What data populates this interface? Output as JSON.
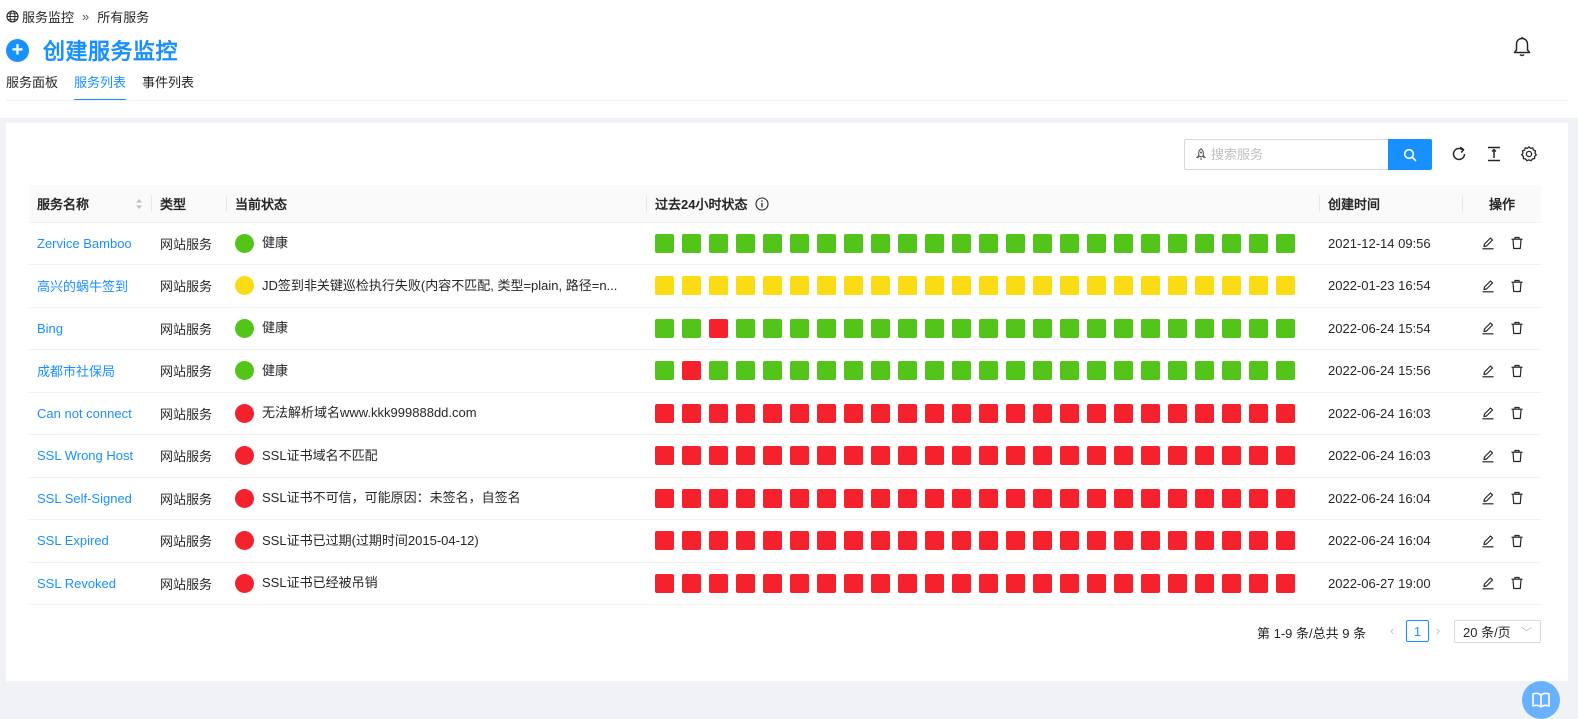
{
  "breadcrumb": {
    "root": "服务监控",
    "separator": "»",
    "current": "所有服务"
  },
  "header": {
    "create_label": "创建服务监控"
  },
  "tabs": [
    {
      "label": "服务面板",
      "active": false
    },
    {
      "label": "服务列表",
      "active": true
    },
    {
      "label": "事件列表",
      "active": false
    }
  ],
  "search": {
    "placeholder": "搜索服务",
    "value": ""
  },
  "colors": {
    "accent": "#1890ff",
    "healthy": "#52c41a",
    "warning": "#fadb14",
    "error": "#f5222d"
  },
  "table": {
    "columns": [
      "服务名称",
      "类型",
      "当前状态",
      "过去24小时状态",
      "创建时间",
      "操作"
    ],
    "rows": [
      {
        "name": "Zervice Bamboo",
        "type": "网站服务",
        "status": "healthy",
        "status_text": "健康",
        "history": "GGGGGGGGGGGGGGGGGGGGGGGG",
        "created": "2021-12-14 09:56"
      },
      {
        "name": "高兴的蜗牛签到",
        "type": "网站服务",
        "status": "warning",
        "status_text": "JD签到非关键巡检执行失败(内容不匹配, 类型=plain, 路径=n...",
        "history": "YYYYYYYYYYYYYYYYYYYYYYYY",
        "created": "2022-01-23 16:54"
      },
      {
        "name": "Bing",
        "type": "网站服务",
        "status": "healthy",
        "status_text": "健康",
        "history": "GGRGGGGGGGGGGGGGGGGGGGGG",
        "created": "2022-06-24 15:54"
      },
      {
        "name": "成都市社保局",
        "type": "网站服务",
        "status": "healthy",
        "status_text": "健康",
        "history": "GRGGGGGGGGGGGGGGGGGGGGGG",
        "created": "2022-06-24 15:56"
      },
      {
        "name": "Can not connect",
        "type": "网站服务",
        "status": "error",
        "status_text": "无法解析域名www.kkk999888dd.com",
        "history": "RRRRRRRRRRRRRRRRRRRRRRRR",
        "created": "2022-06-24 16:03"
      },
      {
        "name": "SSL Wrong Host",
        "type": "网站服务",
        "status": "error",
        "status_text": "SSL证书域名不匹配",
        "history": "RRRRRRRRRRRRRRRRRRRRRRRR",
        "created": "2022-06-24 16:03"
      },
      {
        "name": "SSL Self-Signed",
        "type": "网站服务",
        "status": "error",
        "status_text": "SSL证书不可信，可能原因：未签名，自签名",
        "history": "RRRRRRRRRRRRRRRRRRRRRRRR",
        "created": "2022-06-24 16:04"
      },
      {
        "name": "SSL Expired",
        "type": "网站服务",
        "status": "error",
        "status_text": "SSL证书已过期(过期时间2015-04-12)",
        "history": "RRRRRRRRRRRRRRRRRRRRRRRR",
        "created": "2022-06-24 16:04"
      },
      {
        "name": "SSL Revoked",
        "type": "网站服务",
        "status": "error",
        "status_text": "SSL证书已经被吊销",
        "history": "RRRRRRRRRRRRRRRRRRRRRRRR",
        "created": "2022-06-27 19:00"
      }
    ]
  },
  "pagination": {
    "total_text": "第 1-9 条/总共 9 条",
    "current_page": "1",
    "page_size": "20 条/页"
  },
  "icons": {
    "breadcrumb": "globe-icon",
    "create": "plus-circle-icon",
    "notifications": "bell-icon",
    "search_prefix": "rocket-icon",
    "search_button": "search-icon",
    "refresh": "reload-icon",
    "density": "column-height-icon",
    "settings": "gear-icon",
    "history_info": "info-circle-icon",
    "edit": "edit-icon",
    "delete": "trash-icon",
    "help": "book-icon"
  }
}
